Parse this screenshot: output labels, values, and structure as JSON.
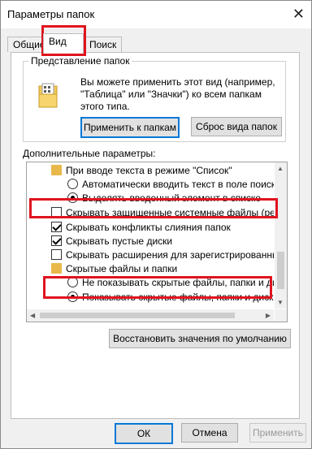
{
  "window": {
    "title": "Параметры папок",
    "close_glyph": "✕"
  },
  "tabs": [
    {
      "label": "Общие"
    },
    {
      "label": "Вид"
    },
    {
      "label": "Поиск"
    }
  ],
  "folder_views": {
    "title": "Представление папок",
    "description": "Вы можете применить этот вид (например, \"Таблица\" или \"Значки\") ко всем папкам этого типа.",
    "apply_label": "Применить к папкам",
    "reset_label": "Сброс вида папок"
  },
  "advanced": {
    "title": "Дополнительные параметры:",
    "items": [
      {
        "text": "При вводе текста в режиме \"Список\"",
        "kind": "folder"
      },
      {
        "text": "Автоматически вводить текст в поле поиска",
        "kind": "radio",
        "checked": false
      },
      {
        "text": "Выделять введенный элемент в списке",
        "kind": "radio",
        "checked": true
      },
      {
        "text": "Скрывать защищенные системные файлы (рекомен",
        "kind": "checkbox",
        "checked": false
      },
      {
        "text": "Скрывать конфликты слияния папок",
        "kind": "checkbox",
        "checked": true
      },
      {
        "text": "Скрывать пустые диски",
        "kind": "checkbox",
        "checked": true
      },
      {
        "text": "Скрывать расширения для зарегистрированных типо",
        "kind": "checkbox",
        "checked": false
      },
      {
        "text": "Скрытые файлы и папки",
        "kind": "folder"
      },
      {
        "text": "Не показывать скрытые файлы, папки и диски",
        "kind": "radio",
        "checked": false
      },
      {
        "text": "Показывать скрытые файлы, папки и диски",
        "kind": "radio",
        "checked": true
      }
    ],
    "restore_label": "Восстановить значения по умолчанию"
  },
  "footer": {
    "ok": "ОК",
    "cancel": "Отмена",
    "apply": "Применить"
  },
  "colors": {
    "highlight": "#e0141e",
    "accent": "#0078d7",
    "folder": "#e8b84a"
  }
}
